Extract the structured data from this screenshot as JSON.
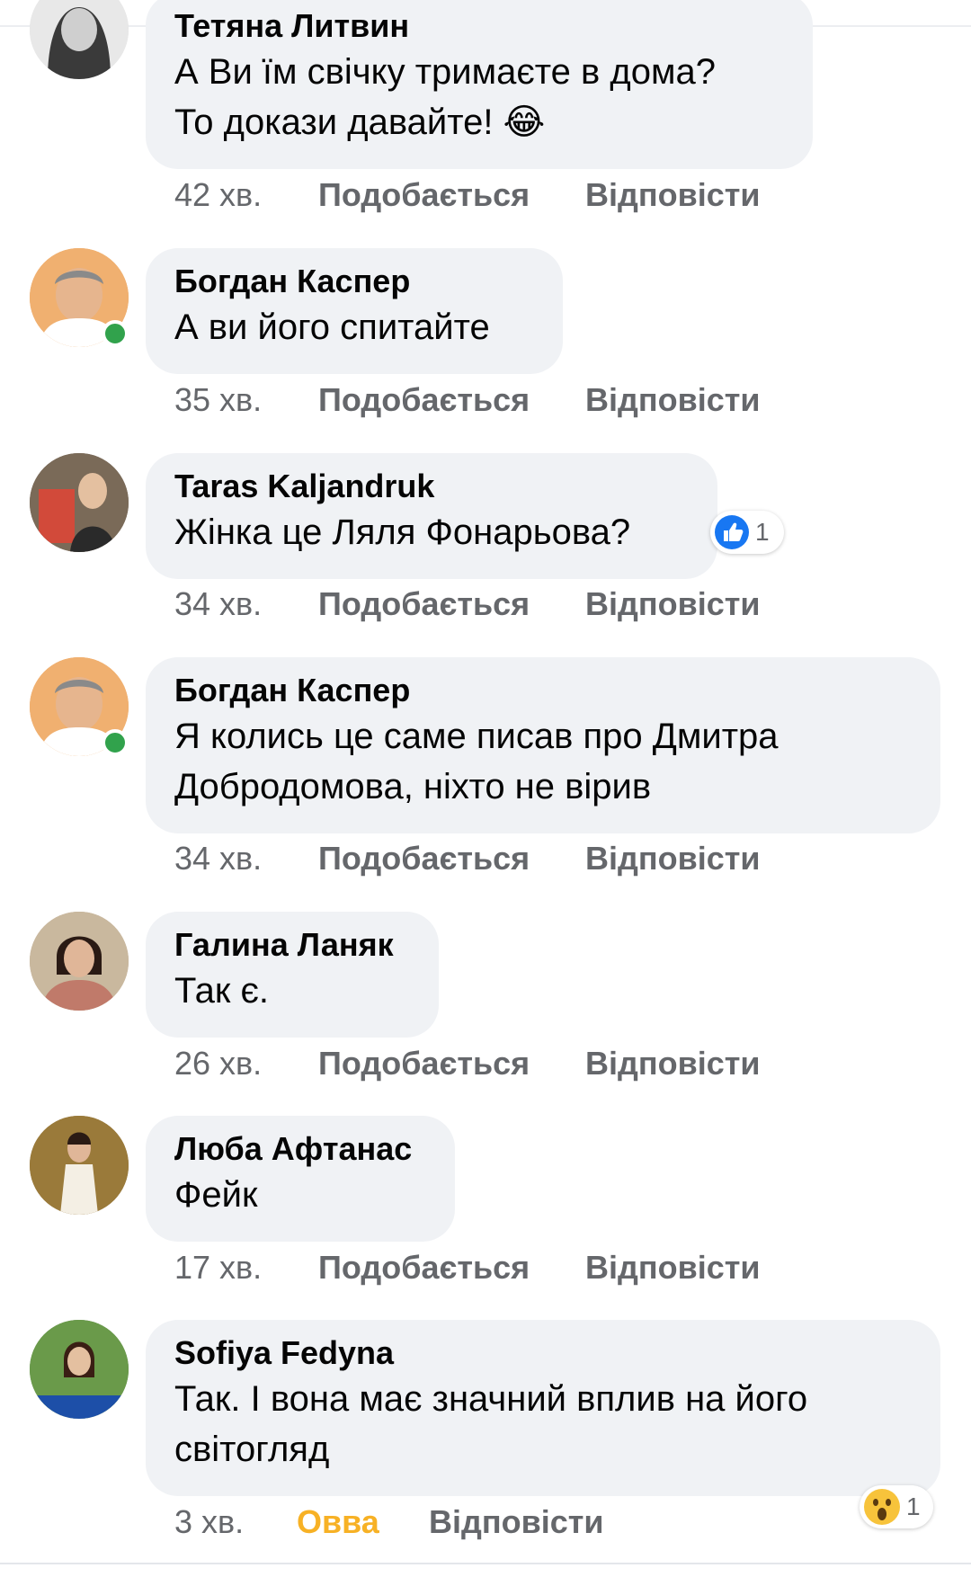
{
  "comments": [
    {
      "author": "Тетяна Литвин",
      "lines": [
        "А Ви їм свічку тримаєте в дома?",
        "То докази давайте! 😂"
      ],
      "time": "42 хв.",
      "like_label": "Подобається",
      "reply_label": "Відповісти"
    },
    {
      "author": "Богдан Каспер",
      "lines": [
        "А ви його спитайте"
      ],
      "time": "35 хв.",
      "like_label": "Подобається",
      "reply_label": "Відповісти"
    },
    {
      "author": "Taras Kaljandruk",
      "lines": [
        "Жінка це Ляля Фонарьова?"
      ],
      "time": "34 хв.",
      "like_label": "Подобається",
      "reply_label": "Відповісти",
      "reaction": {
        "icon": "like-icon",
        "count": "1"
      }
    },
    {
      "author": "Богдан Каспер",
      "lines": [
        "Я колись це саме писав про Дмитра",
        "Добродомова, ніхто не вірив"
      ],
      "time": "34 хв.",
      "like_label": "Подобається",
      "reply_label": "Відповісти"
    },
    {
      "author": "Галина Ланяк",
      "lines": [
        "Так є."
      ],
      "time": "26 хв.",
      "like_label": "Подобається",
      "reply_label": "Відповісти"
    },
    {
      "author": "Люба Афтанас",
      "lines": [
        "Фейк"
      ],
      "time": "17 хв.",
      "like_label": "Подобається",
      "reply_label": "Відповісти"
    },
    {
      "author": "Sofiya Fedyna",
      "lines": [
        "Так. І вона має значний вплив на його",
        "світогляд"
      ],
      "time": "3 хв.",
      "like_label": "Овва",
      "reply_label": "Відповісти",
      "reaction": {
        "icon": "wow-icon",
        "count": "1"
      }
    }
  ],
  "colors": {
    "bubble": "#f0f2f5",
    "meta": "#65676b",
    "online": "#31a24c",
    "wow_reacted": "#f7b125",
    "like_blue": "#1877f2"
  }
}
